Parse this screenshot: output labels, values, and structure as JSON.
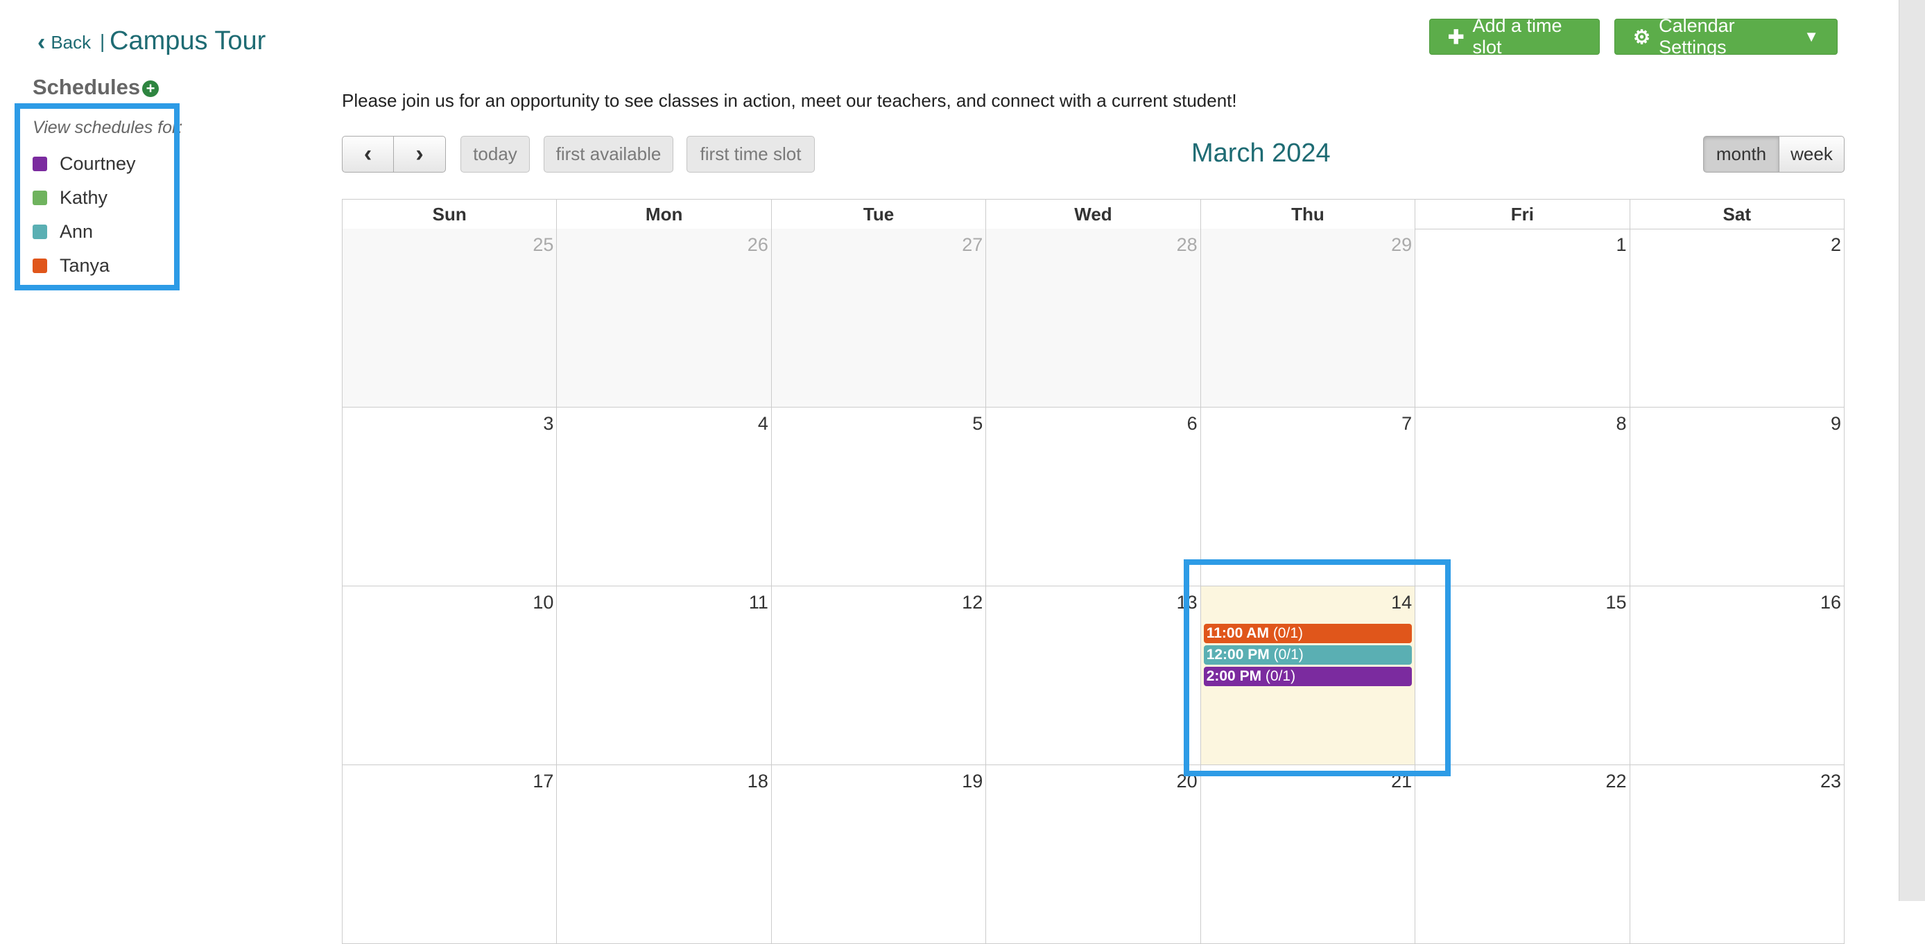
{
  "header": {
    "back_label": "Back",
    "separator": "|",
    "title": "Campus Tour"
  },
  "sidebar": {
    "heading": "Schedules",
    "add_icon_glyph": "+",
    "view_label": "View schedules for:",
    "items": [
      {
        "label": "Courtney",
        "color": "#7b2b9f"
      },
      {
        "label": "Kathy",
        "color": "#6fb35e"
      },
      {
        "label": "Ann",
        "color": "#5aafb3"
      },
      {
        "label": "Tanya",
        "color": "#e0561b"
      }
    ]
  },
  "actions": {
    "add_time_slot": "Add a time slot",
    "calendar_settings": "Calendar Settings"
  },
  "intro_text": "Please join us for an opportunity to see classes in action, meet our teachers, and connect with a current student!",
  "toolbar": {
    "prev_glyph": "‹",
    "next_glyph": "›",
    "today": "today",
    "first_available": "first available",
    "first_time_slot": "first time slot",
    "month_title": "March 2024",
    "view_month": "month",
    "view_week": "week"
  },
  "calendar": {
    "days_of_week": [
      "Sun",
      "Mon",
      "Tue",
      "Wed",
      "Thu",
      "Fri",
      "Sat"
    ],
    "weeks": [
      [
        {
          "num": "25",
          "other": true
        },
        {
          "num": "26",
          "other": true
        },
        {
          "num": "27",
          "other": true
        },
        {
          "num": "28",
          "other": true
        },
        {
          "num": "29",
          "other": true
        },
        {
          "num": "1"
        },
        {
          "num": "2"
        }
      ],
      [
        {
          "num": "3"
        },
        {
          "num": "4"
        },
        {
          "num": "5"
        },
        {
          "num": "6"
        },
        {
          "num": "7"
        },
        {
          "num": "8"
        },
        {
          "num": "9"
        }
      ],
      [
        {
          "num": "10"
        },
        {
          "num": "11"
        },
        {
          "num": "12"
        },
        {
          "num": "13"
        },
        {
          "num": "14",
          "today": true,
          "events": [
            {
              "time": "11:00 AM",
              "count": "(0/1)",
              "color": "#e0561b"
            },
            {
              "time": "12:00 PM",
              "count": "(0/1)",
              "color": "#5aafb3"
            },
            {
              "time": "2:00 PM",
              "count": "(0/1)",
              "color": "#7b2b9f"
            }
          ]
        },
        {
          "num": "15"
        },
        {
          "num": "16"
        }
      ],
      [
        {
          "num": "17"
        },
        {
          "num": "18"
        },
        {
          "num": "19"
        },
        {
          "num": "20"
        },
        {
          "num": "21"
        },
        {
          "num": "22"
        },
        {
          "num": "23"
        }
      ]
    ]
  },
  "colors": {
    "accent_teal": "#1e6b73",
    "button_green": "#5cad4a",
    "highlight_blue": "#2d9be6",
    "today_bg": "#fcf6df"
  }
}
